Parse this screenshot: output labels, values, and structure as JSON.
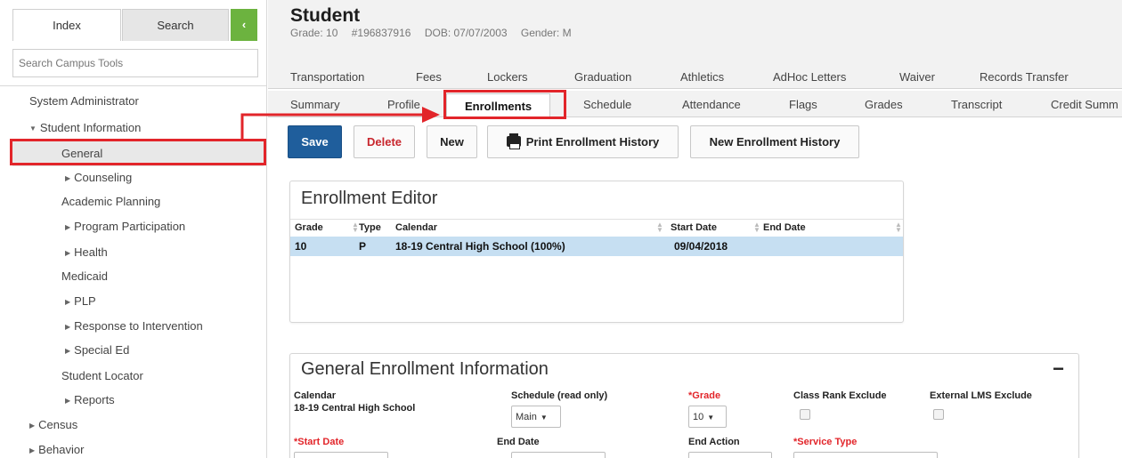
{
  "sidebar": {
    "tab_index": "Index",
    "tab_search": "Search",
    "collapse_glyph": "‹",
    "search_placeholder": "Search Campus Tools",
    "tree": [
      {
        "label": "System Administrator",
        "caret": ""
      },
      {
        "label": "Student Information",
        "caret": "▼"
      },
      {
        "label": "General",
        "caret": ""
      },
      {
        "label": "Counseling",
        "caret": "▶"
      },
      {
        "label": "Academic Planning",
        "caret": ""
      },
      {
        "label": "Program Participation",
        "caret": "▶"
      },
      {
        "label": "Health",
        "caret": "▶"
      },
      {
        "label": "Medicaid",
        "caret": ""
      },
      {
        "label": "PLP",
        "caret": "▶"
      },
      {
        "label": "Response to Intervention",
        "caret": "▶"
      },
      {
        "label": "Special Ed",
        "caret": "▶"
      },
      {
        "label": "Student Locator",
        "caret": ""
      },
      {
        "label": "Reports",
        "caret": "▶"
      },
      {
        "label": "Census",
        "caret": "▶"
      },
      {
        "label": "Behavior",
        "caret": "▶"
      }
    ]
  },
  "header": {
    "title": "Student",
    "grade": "Grade: 10",
    "id": "#196837916",
    "dob": "DOB: 07/07/2003",
    "gender": "Gender: M"
  },
  "tabs_row1": [
    "Transportation",
    "Fees",
    "Lockers",
    "Graduation",
    "Athletics",
    "AdHoc Letters",
    "Waiver",
    "Records Transfer"
  ],
  "tabs_row2": [
    "Summary",
    "Profile",
    "Enrollments",
    "Schedule",
    "Attendance",
    "Flags",
    "Grades",
    "Transcript",
    "Credit Summ"
  ],
  "actions": {
    "save": "Save",
    "delete": "Delete",
    "new": "New",
    "print_history": "Print Enrollment History",
    "new_history": "New Enrollment History"
  },
  "editor": {
    "title": "Enrollment Editor",
    "columns": [
      "Grade",
      "Type",
      "Calendar",
      "Start Date",
      "End Date"
    ],
    "rows": [
      {
        "grade": "10",
        "type": "P",
        "calendar": "18-19 Central High School (100%)",
        "start": "09/04/2018",
        "end": ""
      }
    ]
  },
  "general": {
    "title": "General Enrollment Information",
    "collapse": "−",
    "calendar_label": "Calendar",
    "calendar_value": "18-19 Central High School",
    "schedule_label": "Schedule (read only)",
    "schedule_value": "Main",
    "grade_label": "*Grade",
    "grade_value": "10",
    "class_rank_label": "Class Rank Exclude",
    "external_lms_label": "External LMS Exclude",
    "start_date_label": "*Start Date",
    "end_date_label": "End Date",
    "end_action_label": "End Action",
    "service_type_label": "*Service Type"
  },
  "colors": {
    "accent_blue": "#1f5e9c",
    "highlight_red": "#e2252a",
    "collapse_green": "#6cb33f",
    "row_selected": "#c6dff2"
  }
}
